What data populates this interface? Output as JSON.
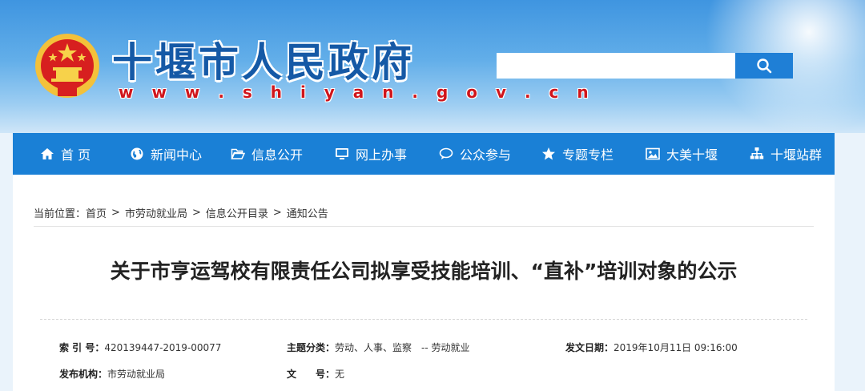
{
  "header": {
    "site_title": "十堰市人民政府",
    "site_url": "w w w . s h i y a n . g o v . c n",
    "search": {
      "placeholder": "",
      "button_icon": "search-icon"
    }
  },
  "nav": {
    "items": [
      {
        "label": "首 页",
        "icon": "home-icon"
      },
      {
        "label": "新闻中心",
        "icon": "globe-icon"
      },
      {
        "label": "信息公开",
        "icon": "folder-icon"
      },
      {
        "label": "网上办事",
        "icon": "monitor-icon"
      },
      {
        "label": "公众参与",
        "icon": "chat-icon"
      },
      {
        "label": "专题专栏",
        "icon": "star-icon"
      },
      {
        "label": "大美十堰",
        "icon": "picture-icon"
      },
      {
        "label": "十堰站群",
        "icon": "sitemap-icon"
      }
    ]
  },
  "breadcrumb": {
    "prefix": "当前位置：",
    "items": [
      "首页",
      "市劳动就业局",
      "信息公开目录",
      "通知公告"
    ],
    "separator": ">"
  },
  "article": {
    "title": "关于市亨运驾校有限责任公司拟享受技能培训、“直补”培训对象的公示"
  },
  "meta": {
    "index_label": "索 引 号：",
    "index_value": "420139447-2019-00077",
    "topic_label": "主题分类：",
    "topic_value": "劳动、人事、监察　-- 劳动就业",
    "date_label": "发文日期：",
    "date_value": "2019年10月11日 09:16:00",
    "publisher_label": "发布机构：",
    "publisher_value": "市劳动就业局",
    "docno_label": "文　　号：",
    "docno_value": "无"
  },
  "colors": {
    "nav_bg": "#1a80d6",
    "title_blue": "#1559a6",
    "url_red": "#d0151b"
  }
}
